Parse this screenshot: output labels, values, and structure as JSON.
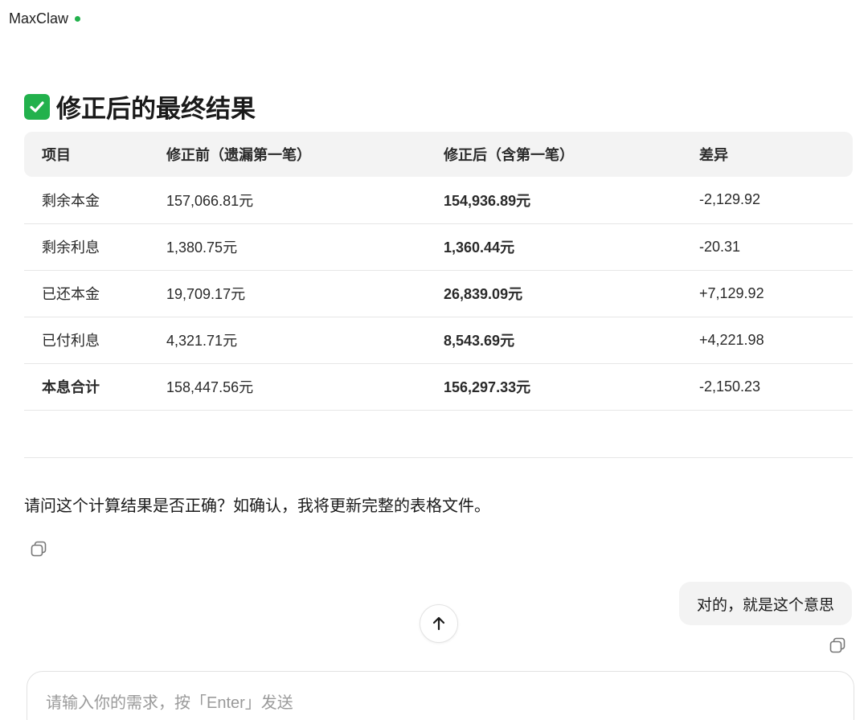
{
  "header": {
    "app_title": "MaxClaw",
    "status_color": "#22b14c"
  },
  "section": {
    "icon": "check-mark-icon",
    "title": "修正后的最终结果"
  },
  "table": {
    "headers": [
      "项目",
      "修正前（遗漏第一笔）",
      "修正后（含第一笔）",
      "差异"
    ],
    "rows": [
      {
        "item": "剩余本金",
        "before": "157,066.81元",
        "after": "154,936.89元",
        "diff": "-2,129.92"
      },
      {
        "item": "剩余利息",
        "before": "1,380.75元",
        "after": "1,360.44元",
        "diff": "-20.31"
      },
      {
        "item": "已还本金",
        "before": "19,709.17元",
        "after": "26,839.09元",
        "diff": "+7,129.92"
      },
      {
        "item": "已付利息",
        "before": "4,321.71元",
        "after": "8,543.69元",
        "diff": "+4,221.98"
      },
      {
        "item": "本息合计",
        "before": "158,447.56元",
        "after": "156,297.33元",
        "diff": "-2,150.23"
      }
    ]
  },
  "assistant_message": {
    "question": "请问这个计算结果是否正确？如确认，我将更新完整的表格文件。"
  },
  "user_message": {
    "text": "对的，就是这个意思"
  },
  "composer": {
    "placeholder": "请输入你的需求，按「Enter」发送",
    "value": ""
  },
  "colors": {
    "accent_green": "#22b14c",
    "header_bg": "#f3f3f3",
    "bubble_bg": "#f3f3f3"
  }
}
